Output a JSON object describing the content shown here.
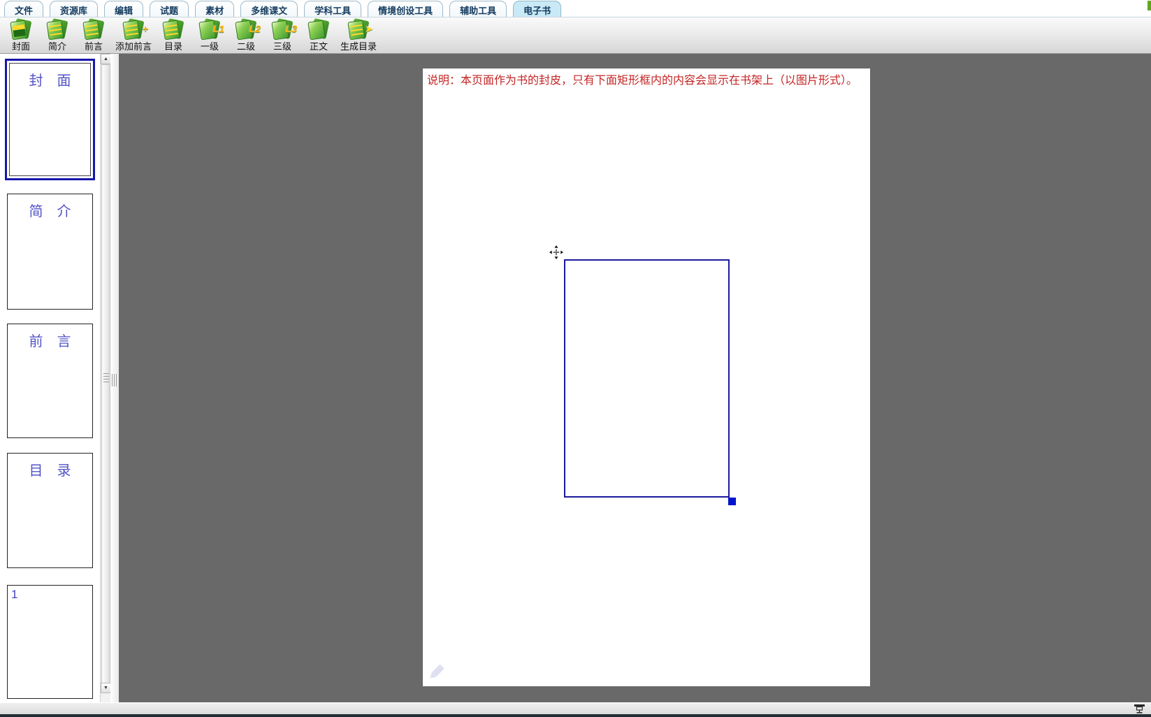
{
  "window": {
    "canvas_bg": "#696969",
    "selection_blue": "#1b1b9e",
    "handle_blue": "#0014cc",
    "note_red": "#c42525",
    "thumb_title_blue": "#5353c8",
    "active_tab_bg": "#c9e9f6"
  },
  "tabs": {
    "items": [
      {
        "label": "文件",
        "active": false
      },
      {
        "label": "资源库",
        "active": false
      },
      {
        "label": "编辑",
        "active": false
      },
      {
        "label": "试题",
        "active": false
      },
      {
        "label": "素材",
        "active": false
      },
      {
        "label": "多维课文",
        "active": false
      },
      {
        "label": "学科工具",
        "active": false
      },
      {
        "label": "情境创设工具",
        "active": false
      },
      {
        "label": "辅助工具",
        "active": false
      },
      {
        "label": "电子书",
        "active": true
      }
    ]
  },
  "toolbar": {
    "buttons": [
      {
        "label": "封面",
        "badge": "",
        "icon": "cover-doc-icon"
      },
      {
        "label": "简介",
        "badge": "",
        "icon": "intro-doc-icon"
      },
      {
        "label": "前言",
        "badge": "",
        "icon": "preface-doc-icon"
      },
      {
        "label": "添加前言",
        "badge": "+",
        "icon": "add-preface-doc-icon"
      },
      {
        "label": "目录",
        "badge": "",
        "icon": "toc-doc-icon"
      },
      {
        "label": "一级",
        "badge": "L1",
        "icon": "level1-doc-icon"
      },
      {
        "label": "二级",
        "badge": "L2",
        "icon": "level2-doc-icon"
      },
      {
        "label": "三级",
        "badge": "L3",
        "icon": "level3-doc-icon"
      },
      {
        "label": "正文",
        "badge": "",
        "icon": "body-doc-icon"
      },
      {
        "label": "生成目录",
        "badge": "➤",
        "icon": "generate-toc-doc-icon"
      }
    ]
  },
  "sidebar": {
    "thumbnails": [
      {
        "title": "封　面",
        "selected": true
      },
      {
        "title": "简　介",
        "selected": false
      },
      {
        "title": "前　言",
        "selected": false
      },
      {
        "title": "目　录",
        "selected": false
      },
      {
        "title": "1",
        "selected": false
      }
    ]
  },
  "canvas": {
    "note": "说明：本页面作为书的封皮，只有下面矩形框内的内容会显示在书架上（以图片形式）。"
  },
  "scrollbar": {
    "up_glyph": "▲",
    "down_glyph": "▼"
  }
}
